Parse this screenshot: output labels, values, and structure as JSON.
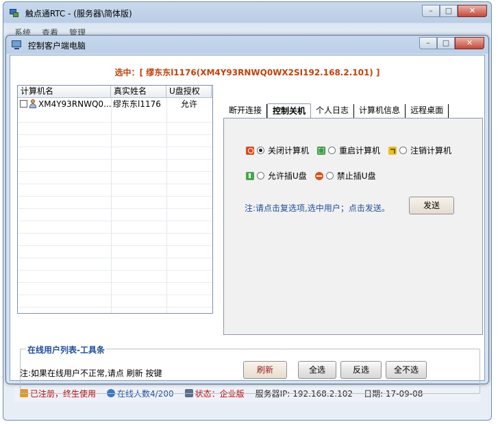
{
  "main_window": {
    "title": "触点通RTC - (服务器\\简体版)",
    "menu": [
      "系统",
      "查看",
      "管理"
    ],
    "status_bar": {
      "registration": "已注册，终生使用",
      "online_count": "在线人数4/200",
      "status": "状态：企业版",
      "server_ip": "服务器IP: 192.168.2.102",
      "date": "日期: 17-09-08"
    }
  },
  "dialog": {
    "title": "控制客户端电脑",
    "selected": "选中：[ 缪东东l1176(XM4Y93RNWQ0WX2SI192.168.2.101) ]",
    "list": {
      "columns": [
        "计算机名",
        "真实姓名",
        "U盘授权"
      ],
      "rows": [
        {
          "computer": "XM4Y93RNWQ0...",
          "name": "缪东东l1176",
          "usb": "允许"
        }
      ]
    },
    "tabs": [
      {
        "label": "断开连接",
        "active": false
      },
      {
        "label": "控制关机",
        "active": true
      },
      {
        "label": "个人日志",
        "active": false
      },
      {
        "label": "计算机信息",
        "active": false
      },
      {
        "label": "远程桌面",
        "active": false
      }
    ],
    "control": {
      "shutdown": "关闭计算机",
      "restart": "重启计算机",
      "logout": "注销计算机",
      "allow_usb": "允许插U盘",
      "deny_usb": "禁止插U盘",
      "note": "注:请点击复选项,选中用户；点击发送。",
      "send": "发送"
    },
    "toolbar": {
      "group_title": "在线用户列表-工具条",
      "hint": "注:如果在线用户不正常,请点 刷新 按键",
      "refresh": "刷新",
      "select_all": "全选",
      "invert": "反选",
      "select_none": "全不选"
    }
  }
}
